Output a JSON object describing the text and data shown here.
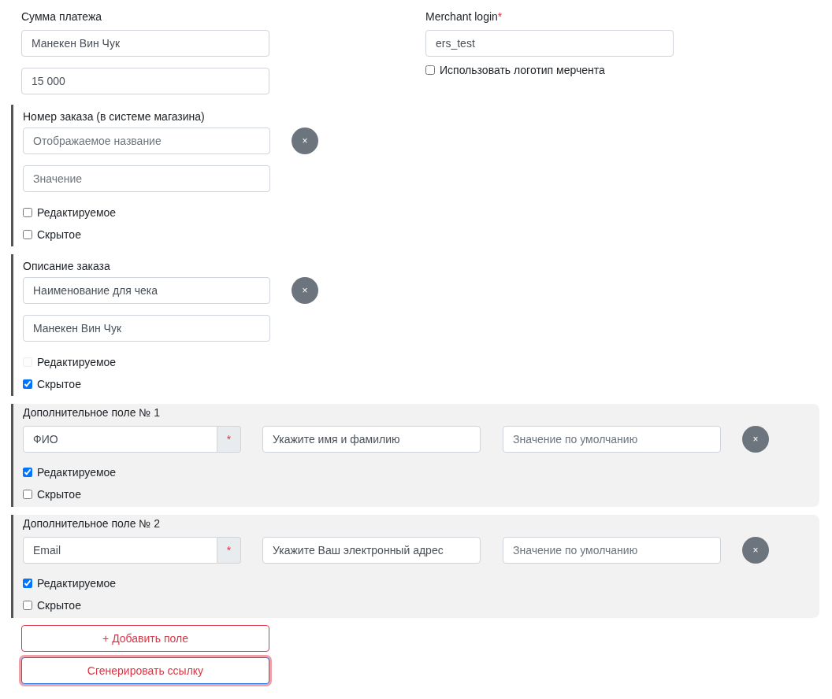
{
  "payment": {
    "label": "Сумма платежа",
    "fields": [
      {
        "value": "Манекен Вин Чук"
      },
      {
        "value": "15 000"
      }
    ]
  },
  "merchant": {
    "label": "Merchant login",
    "required_mark": "*",
    "field": {
      "value": "ers_test"
    },
    "logo_checkbox": {
      "label": "Использовать логотип мерчента",
      "checked": false
    }
  },
  "groups": [
    {
      "kind": "standard",
      "title": "Номер заказа (в системе магазина)",
      "name_field": {
        "placeholder": "Отображаемое название"
      },
      "value_field": {
        "placeholder": "Значение"
      },
      "remove": "×",
      "checkboxes": [
        {
          "label": "Редактируемое",
          "checked": false,
          "disabled": false
        },
        {
          "label": "Скрытое",
          "checked": false,
          "disabled": false
        }
      ]
    },
    {
      "kind": "standard",
      "title": "Описание заказа",
      "name_field": {
        "value": "Наименование для чека"
      },
      "value_field": {
        "value": "Манекен Вин Чук"
      },
      "remove": "×",
      "checkboxes": [
        {
          "label": "Редактируемое",
          "checked": false,
          "disabled": true
        },
        {
          "label": "Скрытое",
          "checked": true,
          "disabled": false
        }
      ]
    },
    {
      "kind": "extra",
      "title": "Дополнительное поле № 1",
      "name_field": {
        "value": "ФИО"
      },
      "required_addon": "*",
      "hint_field": {
        "value": "Укажите имя и фамилию"
      },
      "default_field": {
        "placeholder": "Значение по умолчанию"
      },
      "remove": "×",
      "checkboxes": [
        {
          "label": "Редактируемое",
          "checked": true,
          "disabled": false
        },
        {
          "label": "Скрытое",
          "checked": false,
          "disabled": false
        }
      ]
    },
    {
      "kind": "extra",
      "title": "Дополнительное поле № 2",
      "name_field": {
        "value": "Email"
      },
      "required_addon": "*",
      "hint_field": {
        "value": "Укажите Ваш электронный адрес"
      },
      "default_field": {
        "placeholder": "Значение по умолчанию"
      },
      "remove": "×",
      "checkboxes": [
        {
          "label": "Редактируемое",
          "checked": true,
          "disabled": false
        },
        {
          "label": "Скрытое",
          "checked": false,
          "disabled": false
        }
      ]
    }
  ],
  "buttons": [
    {
      "label": "+ Добавить поле",
      "focused": false
    },
    {
      "label": "Сгенерировать ссылку",
      "focused": true
    }
  ]
}
